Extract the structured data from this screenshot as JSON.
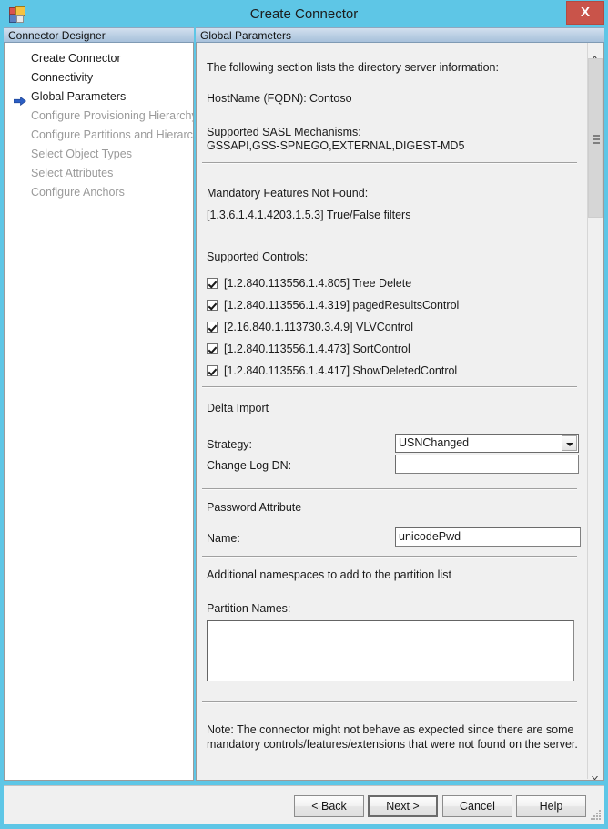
{
  "window": {
    "title": "Create Connector",
    "close_label": "X",
    "app_icon": "connector-app-icon"
  },
  "sidebar": {
    "header": "Connector Designer",
    "items": [
      {
        "label": "Create Connector",
        "state": "done"
      },
      {
        "label": "Connectivity",
        "state": "done"
      },
      {
        "label": "Global Parameters",
        "state": "current"
      },
      {
        "label": "Configure Provisioning Hierarchy",
        "state": "disabled"
      },
      {
        "label": "Configure Partitions and Hierarchies",
        "state": "disabled"
      },
      {
        "label": "Select Object Types",
        "state": "disabled"
      },
      {
        "label": "Select Attributes",
        "state": "disabled"
      },
      {
        "label": "Configure Anchors",
        "state": "disabled"
      }
    ]
  },
  "content": {
    "header": "Global Parameters",
    "intro": "The following section lists the directory server information:",
    "hostname_label": "HostName (FQDN):",
    "hostname_value": "Contoso",
    "sasl_label": "Supported SASL Mechanisms:",
    "sasl_value": "GSSAPI,GSS-SPNEGO,EXTERNAL,DIGEST-MD5",
    "mandatory_label": "Mandatory Features Not Found:",
    "mandatory_value": "[1.3.6.1.4.1.4203.1.5.3] True/False filters",
    "controls_label": "Supported Controls:",
    "controls": [
      {
        "label": "[1.2.840.113556.1.4.805] Tree Delete",
        "checked": true
      },
      {
        "label": "[1.2.840.113556.1.4.319] pagedResultsControl",
        "checked": true
      },
      {
        "label": "[2.16.840.1.113730.3.4.9] VLVControl",
        "checked": true
      },
      {
        "label": "[1.2.840.113556.1.4.473] SortControl",
        "checked": true
      },
      {
        "label": "[1.2.840.113556.1.4.417] ShowDeletedControl",
        "checked": true
      }
    ],
    "delta_import_title": "Delta Import",
    "strategy_label": "Strategy:",
    "strategy_value": "USNChanged",
    "strategy_options": [
      "USNChanged"
    ],
    "changelog_label": "Change Log DN:",
    "changelog_value": "",
    "password_title": "Password Attribute",
    "password_name_label": "Name:",
    "password_name_value": "unicodePwd",
    "namespaces_title": "Additional namespaces to add to the partition list",
    "partition_names_label": "Partition Names:",
    "partition_names_value": "",
    "note": "Note: The connector might not behave as expected since there are some\nmandatory controls/features/extensions that were not found on the server."
  },
  "buttons": {
    "back": "< Back",
    "next": "Next  >",
    "cancel": "Cancel",
    "help": "Help"
  },
  "colors": {
    "window_chrome": "#5ec6e6",
    "close_button": "#c9544a",
    "panel_background": "#f0f0f0",
    "current_step_arrow": "#2b5ec4"
  }
}
